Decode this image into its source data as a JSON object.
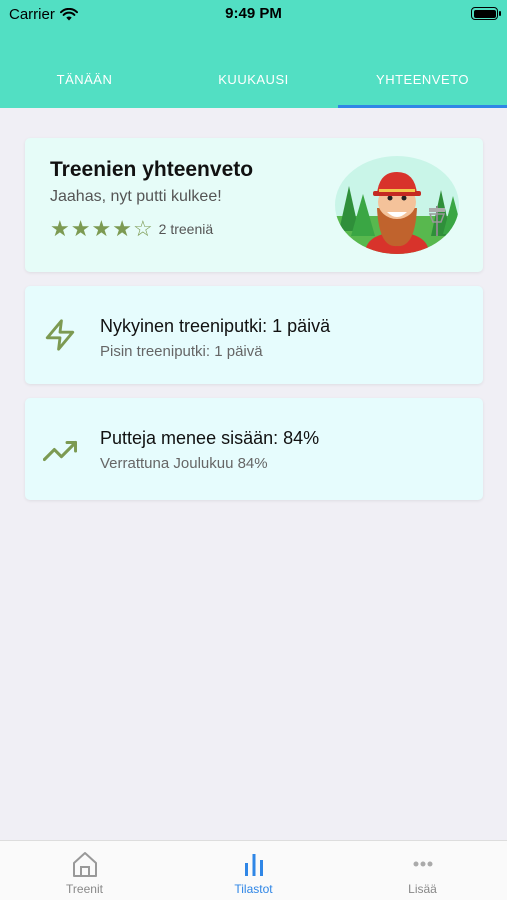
{
  "status_bar": {
    "carrier": "Carrier",
    "time": "9:49 PM"
  },
  "tabs": [
    {
      "label": "TÄNÄÄN",
      "active": false
    },
    {
      "label": "KUUKAUSI",
      "active": false
    },
    {
      "label": "YHTEENVETO",
      "active": true
    }
  ],
  "summary": {
    "title": "Treenien yhteenveto",
    "subtitle": "Jaahas, nyt putti kulkee!",
    "rating": 4,
    "rating_max": 5,
    "count": "2 treeniä"
  },
  "streak": {
    "icon": "lightning-icon",
    "main": "Nykyinen treeniputki: 1 päivä",
    "sub": "Pisin treeniputki: 1 päivä"
  },
  "putts": {
    "icon": "trending-up-icon",
    "main": "Putteja menee sisään: 84%",
    "sub": "Verrattuna Joulukuu 84%"
  },
  "bottom_bar": [
    {
      "label": "Treenit",
      "icon": "home-icon",
      "active": false
    },
    {
      "label": "Tilastot",
      "icon": "bar-chart-icon",
      "active": true
    },
    {
      "label": "Lisää",
      "icon": "more-icon",
      "active": false
    }
  ],
  "colors": {
    "header": "#52dfc3",
    "accent": "#2f86e6",
    "icon_green": "#7c9a52"
  }
}
